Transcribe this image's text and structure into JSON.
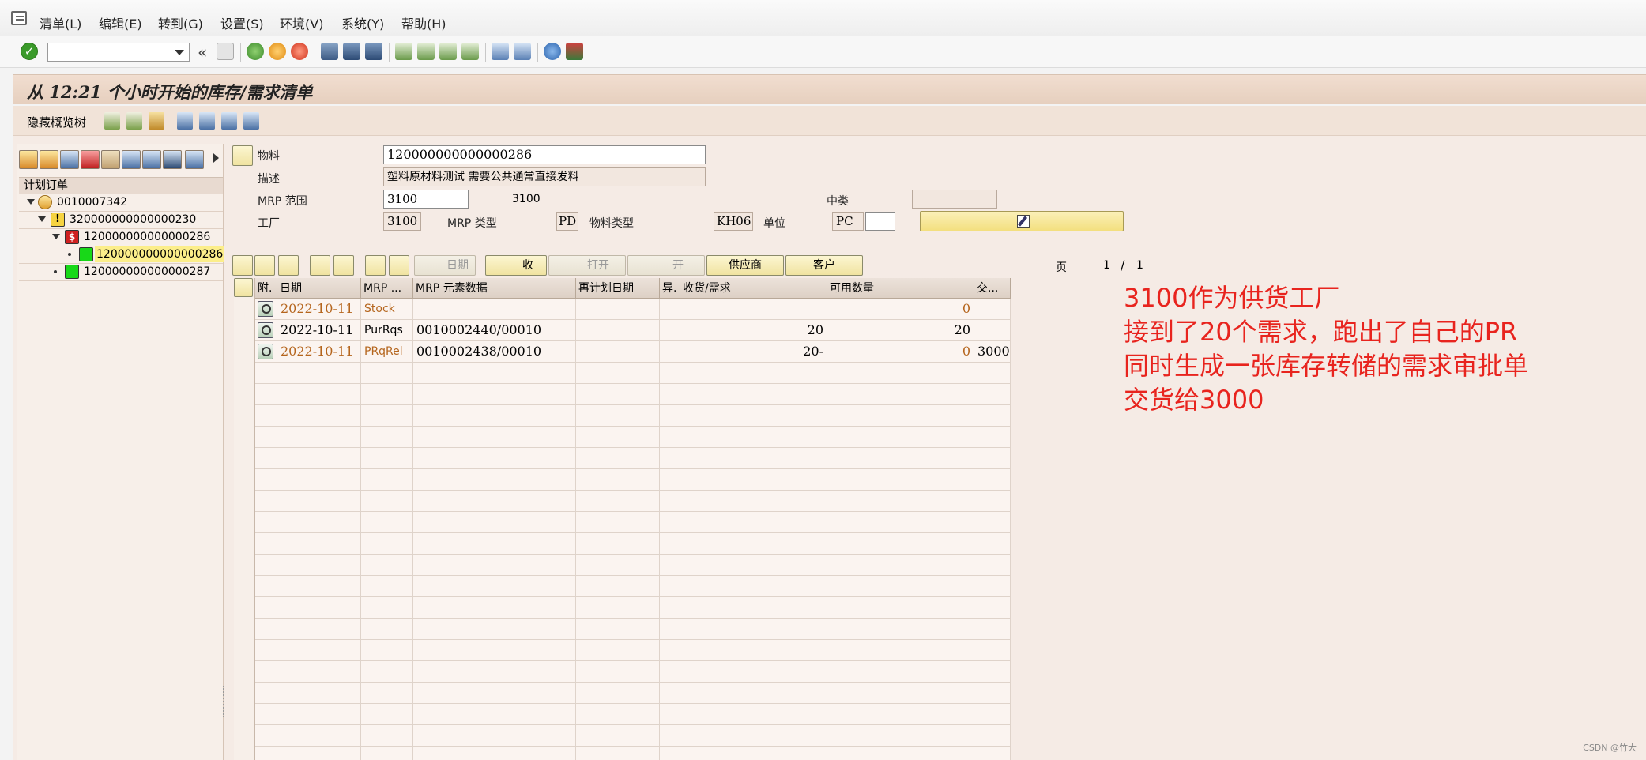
{
  "menu": {
    "items": [
      "清单(L)",
      "编辑(E)",
      "转到(G)",
      "设置(S)",
      "环境(V)",
      "系统(Y)",
      "帮助(H)"
    ]
  },
  "toolbar": {
    "command_field_value": "",
    "back_symbol": "«"
  },
  "title": "从 12:21 个小时开始的库存/需求清单",
  "app_toolbar": {
    "hide_tree_label": "隐藏概览树"
  },
  "tree": {
    "header": "计划订单",
    "nodes": [
      {
        "label": "0010007342",
        "level": 0,
        "icon": "planning-icon"
      },
      {
        "label": "320000000000000230",
        "level": 1,
        "icon": "warning-icon"
      },
      {
        "label": "120000000000000286",
        "level": 2,
        "icon": "red-item-icon"
      },
      {
        "label": "120000000000000286",
        "level": 3,
        "icon": "green-item-icon",
        "selected": true
      },
      {
        "label": "120000000000000287",
        "level": 2,
        "icon": "green-item-icon"
      }
    ]
  },
  "header": {
    "material_label": "物料",
    "material_value": "120000000000000286",
    "desc_label": "描述",
    "desc_value": "塑料原材料测试 需要公共通常直接发料",
    "mrp_area_label": "MRP 范围",
    "mrp_area_value": "3100",
    "mrp_area_text": "3100",
    "mid_class_label": "中类",
    "mid_class_value": "",
    "plant_label": "工厂",
    "plant_value": "3100",
    "mrp_type_label": "MRP 类型",
    "mrp_type_value": "PD",
    "material_type_label": "物料类型",
    "material_type_value": "KH06",
    "unit_label": "单位",
    "unit_value": "PC",
    "unit_extra": ""
  },
  "grid_toolbar": {
    "date_label": "日期",
    "receipt_label": "收",
    "open_label": "打开",
    "open2_label": "开",
    "vendor_label": "供应商",
    "customer_label": "客户"
  },
  "paging": {
    "page_label": "页",
    "current": "1",
    "separator": "/",
    "total": "1"
  },
  "table": {
    "columns": [
      "附.",
      "日期",
      "MRP ...",
      "MRP 元素数据",
      "再计划日期",
      "异.",
      "收货/需求",
      "可用数量",
      "交..."
    ],
    "rows": [
      {
        "date": "2022-10-11",
        "mrp": "Stock",
        "element": "",
        "replan": "",
        "exc": "",
        "qty": "",
        "avail": "0",
        "deliv": "",
        "orange": true
      },
      {
        "date": "2022-10-11",
        "mrp": "PurRqs",
        "element": "0010002440/00010",
        "replan": "",
        "exc": "",
        "qty": "20",
        "avail": "20",
        "deliv": "",
        "orange": false
      },
      {
        "date": "2022-10-11",
        "mrp": "PRqRel",
        "element": "0010002438/00010",
        "replan": "",
        "exc": "",
        "qty": "20-",
        "avail": "0",
        "deliv": "3000",
        "orange": true
      }
    ]
  },
  "annotation": {
    "line1": "3100作为供货工厂",
    "line2": "接到了20个需求，跑出了自己的PR",
    "line3": "同时生成一张库存转储的需求审批单",
    "line4": "交货给3000"
  },
  "watermark": "CSDN @竹大",
  "colors": {
    "title_bg": "#e6cfbe",
    "annotation": "#e8241e",
    "orange_text": "#b5651d",
    "button_yellow": "#f3df7e"
  }
}
